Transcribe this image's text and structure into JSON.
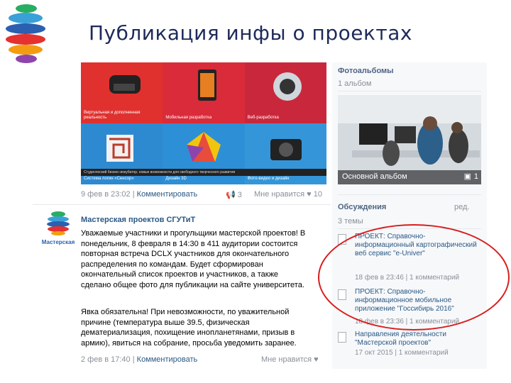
{
  "slide": {
    "title": "Публикация инфы о проектах"
  },
  "grid_tiles": [
    {
      "caption": "Виртуальная и дополненная реальность",
      "color": "#e0312f"
    },
    {
      "caption": "Мобильная разработка",
      "color": "#d92b3a"
    },
    {
      "caption": "Веб-разработка",
      "color": "#c9283c"
    },
    {
      "caption": "Система логин «Сенсор»",
      "color": "#2e8ad0"
    },
    {
      "caption": "Дизайн 3D",
      "color": "#2d8fd5"
    },
    {
      "caption": "Фото-видео и дизайн",
      "color": "#3496d8"
    }
  ],
  "grid_footer": "Студенческий бизнес-инкубатор, новые возможности для свободного творческого развития",
  "post1_meta": {
    "date": "9 фев в 23:02",
    "comment": "Комментировать",
    "shares": "3",
    "likes_label": "Мне нравится",
    "likes": "10"
  },
  "post2": {
    "avatar_caption": "Мастерская",
    "author": "Мастерская проектов СГУТиТ",
    "para1": [
      "Уважаемые участники и прогульщики мастерской проектов! В",
      "понедельник, 8 февраля в 14:30 в 411 аудитории состоится",
      "повторная встреча DCLX участников для окончательного",
      "распределения по командам. Будет сформирован",
      "окончательный список проектов и участников, а также",
      "сделано общее фото для публикации на сайте университета."
    ],
    "para2": [
      "Явка обязательна! При невозможности, по уважительной",
      "причине (температура выше 39.5, физическая",
      "дематериализация, похищение инопланетянами, призыв в",
      "армию), явиться на собрание, просьба уведомить заранее."
    ],
    "date": "2 фев в 17:40",
    "comment": "Комментировать",
    "likes_label": "Мне нравится"
  },
  "right": {
    "photos_title": "Фотоальбомы",
    "photos_count": "1 альбом",
    "album_name": "Основной альбом",
    "album_count": "1",
    "discussions_title": "Обсуждения",
    "edit": "ред.",
    "topics_count": "3 темы",
    "topics": [
      {
        "title": "ПРОЕКТ: Справочно-информационный картографический веб сервис \"e-Univer\"",
        "time": "18 фев в 23:46 | 1 комментарий"
      },
      {
        "title": "ПРОЕКТ: Справочно-информационное мобильное приложение \"Госсибирь 2016\"",
        "time": "18 фев в 23:36 | 1 комментарий"
      },
      {
        "title": "Направления деятельности \"Мастерской проектов\"",
        "time": "17 окт 2015 | 1 комментарий"
      }
    ]
  },
  "colors": {
    "accent_circle": "#d81e1e",
    "link": "#2a5885"
  }
}
